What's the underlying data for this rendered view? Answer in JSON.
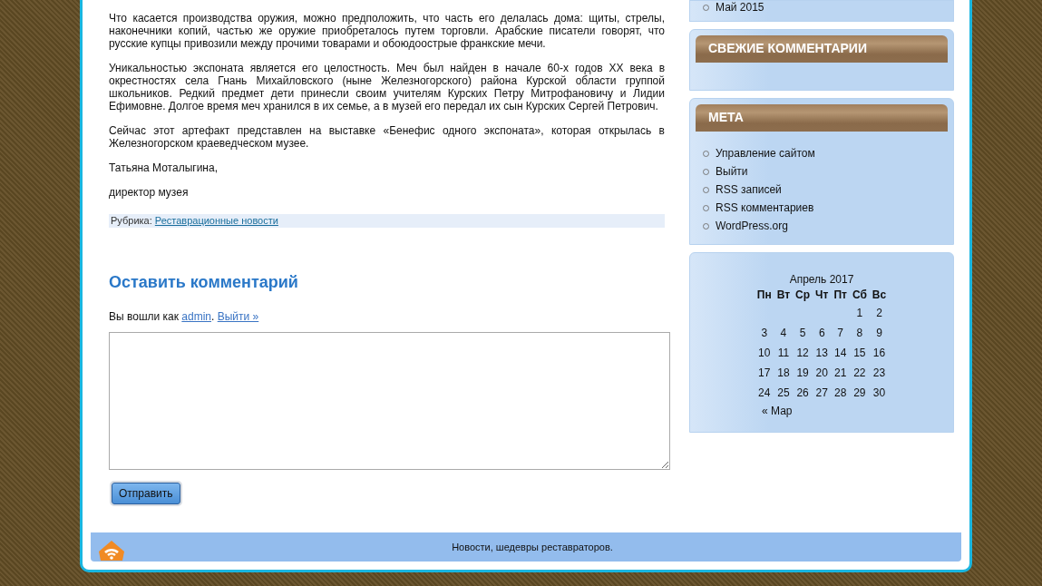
{
  "article": {
    "paragraphs": [
      "Что касается производства оружия, можно предположить, что часть его делалась дома: щиты, стрелы, наконечники копий, частью же оружие приобреталось путем торговли. Арабские писатели говорят, что русские купцы привозили между прочими товарами и обоюдоострые франкские мечи.",
      "Уникальностью экспоната является его целостность. Меч был найден в начале 60-х годов XX века в окрестностях села Гнань Михайловского (ныне Железногорского) района Курской области группой школьников. Редкий предмет дети принесли своим учителям Курских Петру Митрофановичу и Лидии Ефимовне. Долгое время меч хранился в их семье, а в музей его передал их сын Курских Сергей Петрович.",
      "Сейчас этот артефакт представлен на выставке «Бенефис одного экспоната», которая открылась в Железногорском краеведческом музее.",
      "Татьяна Моталыгина,",
      "директор музея"
    ],
    "category_label": "Рубрика:",
    "category_link": "Реставрационные новости"
  },
  "comment_form": {
    "heading": "Оставить комментарий",
    "logged_in_text": "Вы вошли как",
    "user_link": "admin",
    "separator": ".",
    "logout_link": "Выйти »",
    "submit": "Отправить"
  },
  "sidebar": {
    "archive_items": [
      "Май 2015"
    ],
    "widgets": [
      {
        "kind": "list",
        "title": "СВЕЖИЕ КОММЕНТАРИИ"
      },
      {
        "kind": "list",
        "title": "МЕТА",
        "items": [
          "Управление сайтом",
          "Выйти",
          "RSS записей",
          "RSS комментариев",
          "WordPress.org"
        ]
      }
    ],
    "calendar": {
      "caption": "Апрель 2017",
      "weekdays": [
        "Пн",
        "Вт",
        "Ср",
        "Чт",
        "Пт",
        "Сб",
        "Вс"
      ],
      "weeks": [
        [
          "1",
          "2"
        ],
        [
          "3",
          "4",
          "5",
          "6",
          "7",
          "8",
          "9"
        ],
        [
          "10",
          "11",
          "12",
          "13",
          "14",
          "15",
          "16"
        ],
        [
          "17",
          "18",
          "19",
          "20",
          "21",
          "22",
          "23"
        ],
        [
          "24",
          "25",
          "26",
          "27",
          "28",
          "29",
          "30"
        ]
      ],
      "prev_link": "« Мар"
    }
  },
  "footer": {
    "text": "Новости, шедевры реставраторов."
  }
}
